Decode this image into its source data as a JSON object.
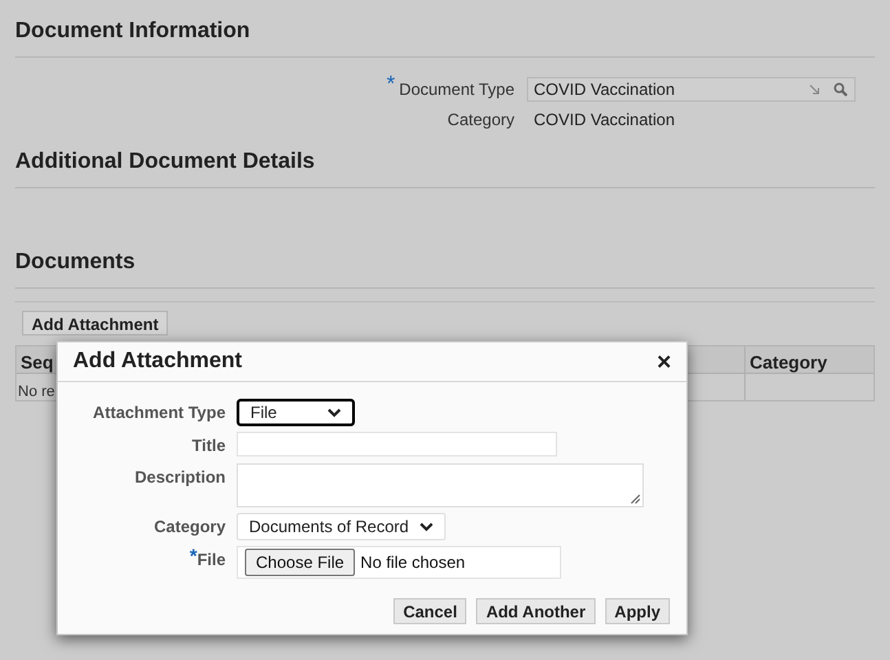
{
  "sections": [
    {
      "title": "Document Information"
    },
    {
      "title": "Additional Document Details"
    },
    {
      "title": "Documents"
    }
  ],
  "document_info": {
    "fields": [
      {
        "kind": "lookup",
        "label": "Document Type",
        "value": "COVID Vaccination",
        "required_mark": "*"
      },
      {
        "kind": "text",
        "label": "Category",
        "value": "COVID Vaccination"
      }
    ]
  },
  "documents": {
    "add_button": "Add Attachment",
    "table": {
      "columns": [
        "Seq",
        "Category"
      ],
      "rows": [
        {
          "column_1": "No re"
        }
      ]
    }
  },
  "dialog": {
    "title": "Add Attachment",
    "close": "×",
    "fields": [
      {
        "kind": "select",
        "label": "Attachment Type",
        "value": "File",
        "focused": true
      },
      {
        "kind": "input",
        "label": "Title"
      },
      {
        "kind": "textarea",
        "label": "Description"
      },
      {
        "kind": "select",
        "label": "Category",
        "value": "Documents of Record",
        "focused": false
      },
      {
        "kind": "file",
        "label": "File",
        "button": "Choose File",
        "value": "No file chosen",
        "required_mark": "*"
      }
    ],
    "buttons": [
      "Cancel",
      "Add Another",
      "Apply"
    ]
  }
}
